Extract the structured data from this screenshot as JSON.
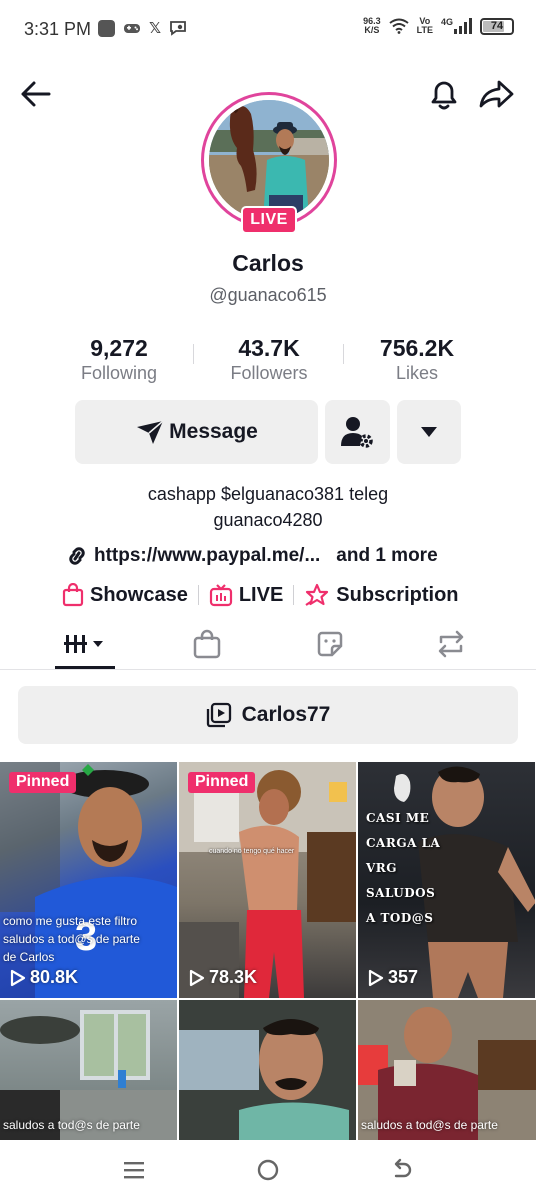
{
  "status_bar": {
    "time": "3:31 PM",
    "speed_value": "96.3",
    "speed_unit": "K/S",
    "volte_top": "Vo",
    "volte_bottom": "LTE",
    "network": "4G",
    "battery": "74",
    "battery_level": 0.74
  },
  "header": {
    "back_icon": "arrow-left-icon",
    "bell_icon": "bell-icon",
    "share_icon": "share-arrow-icon"
  },
  "profile": {
    "live_badge": "LIVE",
    "name": "Carlos",
    "handle": "@guanaco615",
    "ring_color": "#e0449c",
    "live_color": "#ef2f6c"
  },
  "stats": [
    {
      "value": "9,272",
      "label": "Following"
    },
    {
      "value": "43.7K",
      "label": "Followers"
    },
    {
      "value": "756.2K",
      "label": "Likes"
    }
  ],
  "actions": {
    "message_label": "Message",
    "message_icon": "paper-plane-icon",
    "friend_icon": "user-settings-icon",
    "more_icon": "caret-down-icon"
  },
  "bio": {
    "line1": "cashapp $elguanaco381 teleg",
    "line2": "guanaco4280",
    "link": "https://www.paypal.me/...",
    "link_more": "and 1 more"
  },
  "features": [
    {
      "label": "Showcase",
      "icon": "shopping-bag-icon"
    },
    {
      "label": "LIVE",
      "icon": "tv-live-icon"
    },
    {
      "label": "Subscription",
      "icon": "star-badge-icon"
    }
  ],
  "tabs": [
    {
      "icon": "videos-grid-icon",
      "active": true
    },
    {
      "icon": "shop-bag-icon",
      "active": false
    },
    {
      "icon": "sticker-icon",
      "active": false
    },
    {
      "icon": "repost-icon",
      "active": false
    }
  ],
  "playlist": {
    "label": "Carlos77",
    "icon": "playlist-icon"
  },
  "videos": [
    {
      "pinned": "Pinned",
      "views": "80.8K",
      "caption": [
        "como me gusta este filtro",
        "saludos a tod@s de parte",
        "de Carlos"
      ]
    },
    {
      "pinned": "Pinned",
      "views": "78.3K",
      "caption_small": "cuando no tengo qué hacer"
    },
    {
      "views": "357",
      "overlay": [
        "CASI ME",
        "CARGA LA",
        "VRG",
        "SALUDOS",
        "A TOD@S"
      ]
    },
    {
      "caption": [
        "saludos a tod@s de parte"
      ]
    },
    {},
    {
      "caption": [
        "saludos a tod@s de parte"
      ]
    }
  ],
  "nav": {
    "recents_icon": "recents-lines-icon",
    "home_icon": "home-circle-icon",
    "back_icon": "back-arrow-icon"
  }
}
